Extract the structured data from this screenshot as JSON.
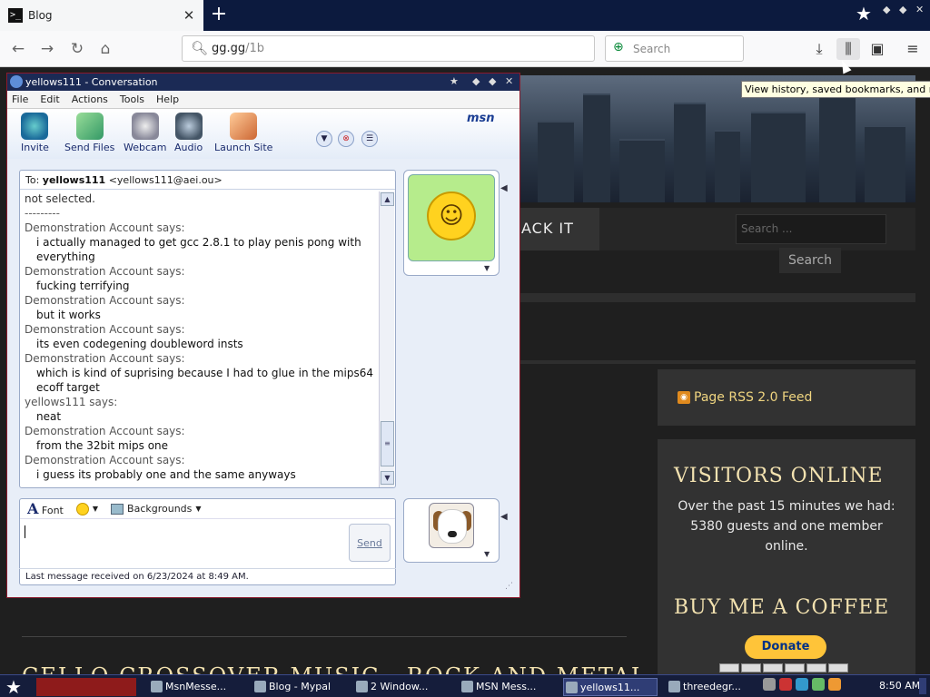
{
  "browser": {
    "tab_title": "Blog",
    "tab_favicon": ">_",
    "tab_close": "✕",
    "new_tab": "+",
    "url_host": "gg.gg",
    "url_path": "/1b",
    "search_placeholder": "Search",
    "tooltip": "View history, saved bookmarks, and more"
  },
  "site": {
    "menu_item": "ACK IT",
    "search_placeholder": "Search ...",
    "search_button": "Search",
    "rss_label": "Page RSS 2.0 Feed",
    "visitors_title": "VISITORS ONLINE",
    "visitors_text": "Over the past 15 minutes we had: 5380 guests and one member online.",
    "coffee_title": "BUY ME A COFFEE",
    "donate_label": "Donate",
    "bottom_title": "CELLO CROSSOVER MUSIC - ROCK AND METAL"
  },
  "msn": {
    "window_title": "yellows111 - Conversation",
    "menu": [
      "File",
      "Edit",
      "Actions",
      "Tools",
      "Help"
    ],
    "toolbar": {
      "invite": "Invite",
      "send_files": "Send Files",
      "webcam": "Webcam",
      "audio": "Audio",
      "launch_site": "Launch Site"
    },
    "logo": "msn",
    "to_label": "To:",
    "to_name": "yellows111",
    "to_email": "<yellows111@aei.ou>",
    "messages": [
      {
        "who": "",
        "text": "not selected."
      },
      {
        "who": "",
        "text": "---------"
      },
      {
        "who": "Demonstration Account says:",
        "text": "i actually managed to get gcc 2.8.1 to play penis pong with everything"
      },
      {
        "who": "Demonstration Account says:",
        "text": "fucking terrifying"
      },
      {
        "who": "Demonstration Account says:",
        "text": "but it works"
      },
      {
        "who": "Demonstration Account says:",
        "text": "its even codegening doubleword insts"
      },
      {
        "who": "Demonstration Account says:",
        "text": "which is kind of suprising because I had to glue in the mips64 ecoff target"
      },
      {
        "who": "yellows111 says:",
        "text": "neat"
      },
      {
        "who": "Demonstration Account says:",
        "text": "from the 32bit mips one"
      },
      {
        "who": "Demonstration Account says:",
        "text": "i guess its probably one and the same anyways"
      }
    ],
    "font_label": "Font",
    "backgrounds_label": "Backgrounds",
    "send_label": "Send",
    "status": "Last message received on 6/23/2024 at 8:49 AM."
  },
  "taskbar": {
    "items": [
      "MsnMesse...",
      "Blog - Mypal",
      "2 Window...",
      "MSN Mess...",
      "yellows11...",
      "threedegr..."
    ],
    "clock": "8:50 AM"
  },
  "colors": {
    "accent": "#1b2a55",
    "site_heading": "#f3e2b0",
    "rss_link": "#f0d580"
  }
}
